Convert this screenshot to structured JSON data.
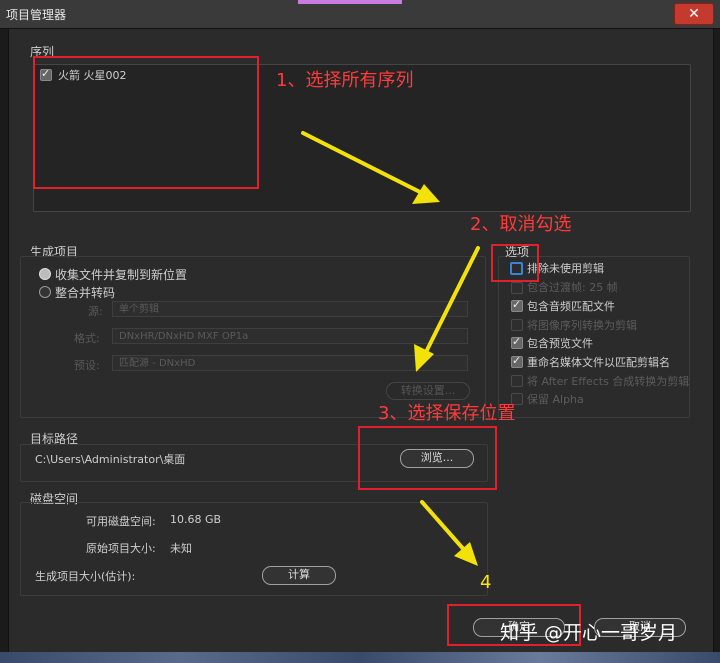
{
  "window": {
    "title": "项目管理器",
    "close_glyph": "✕"
  },
  "sequence": {
    "label": "序列",
    "items": [
      {
        "name": "火箭 火星002",
        "checked": true
      }
    ]
  },
  "generate": {
    "label": "生成项目",
    "radio_collect": "收集文件并复制到新位置",
    "radio_consolidate": "整合并转码",
    "source_label": "源:",
    "source_value": "单个剪辑",
    "format_label": "格式:",
    "format_value": "DNxHR/DNxHD MXF OP1a",
    "preset_label": "预设:",
    "preset_value": "匹配源 - DNxHD",
    "transcode_settings": "转换设置..."
  },
  "options": {
    "label": "选项",
    "items": [
      {
        "label": "排除未使用剪辑",
        "state": "focused"
      },
      {
        "label": "包含过渡帧: 25 帧",
        "state": "disabled"
      },
      {
        "label": "包含音频匹配文件",
        "state": "checked"
      },
      {
        "label": "将图像序列转换为剪辑",
        "state": "disabled"
      },
      {
        "label": "包含预览文件",
        "state": "checked"
      },
      {
        "label": "重命名媒体文件以匹配剪辑名",
        "state": "checked"
      },
      {
        "label": "将 After Effects 合成转换为剪辑",
        "state": "disabled"
      },
      {
        "label": "保留 Alpha",
        "state": "disabled"
      }
    ]
  },
  "destination": {
    "label": "目标路径",
    "path": "C:\\Users\\Administrator\\桌面",
    "browse": "浏览..."
  },
  "disk": {
    "label": "磁盘空间",
    "available_label": "可用磁盘空间:",
    "available_value": "10.68 GB",
    "original_label": "原始项目大小:",
    "original_value": "未知",
    "result_label": "生成项目大小(估计):",
    "compute": "计算"
  },
  "footer": {
    "ok": "确定",
    "cancel": "取消"
  },
  "annotations": {
    "step1": "1、选择所有序列",
    "step2": "2、取消勾选",
    "step3": "3、选择保存位置",
    "step4": "4"
  },
  "watermark": "知乎 @开心一哥岁月"
}
